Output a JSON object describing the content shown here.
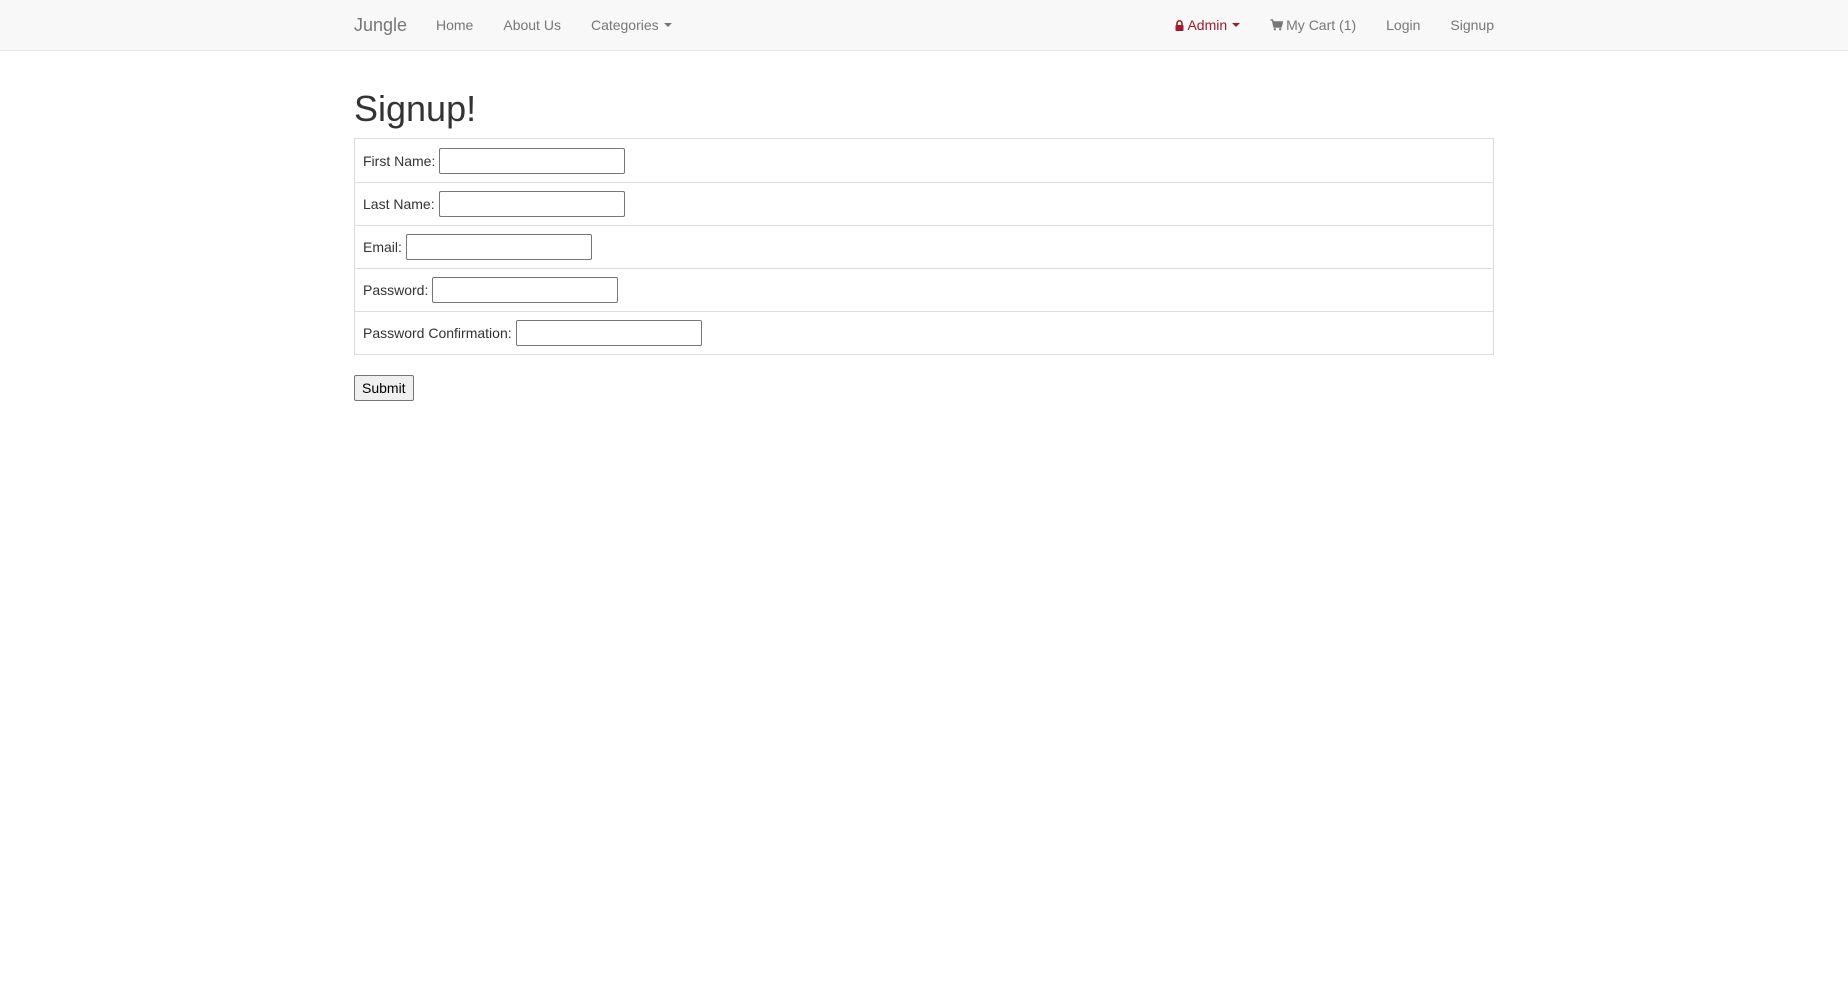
{
  "navbar": {
    "brand": "Jungle",
    "left_links": [
      {
        "label": "Home"
      },
      {
        "label": "About Us"
      },
      {
        "label": "Categories"
      }
    ],
    "right_links": [
      {
        "label": "Admin"
      },
      {
        "label": "My Cart (1)"
      },
      {
        "label": "Login"
      },
      {
        "label": "Signup"
      }
    ],
    "icons": {
      "admin": "lock-icon",
      "cart": "cart-icon"
    },
    "colors": {
      "admin": "#a01c2b",
      "link": "#777777",
      "background": "#f8f8f8"
    }
  },
  "page": {
    "title": "Signup!"
  },
  "form": {
    "fields": [
      {
        "label": "First Name:",
        "value": ""
      },
      {
        "label": "Last Name:",
        "value": ""
      },
      {
        "label": "Email:",
        "value": ""
      },
      {
        "label": "Password:",
        "value": ""
      },
      {
        "label": "Password Confirmation:",
        "value": ""
      }
    ],
    "submit_label": "Submit"
  }
}
